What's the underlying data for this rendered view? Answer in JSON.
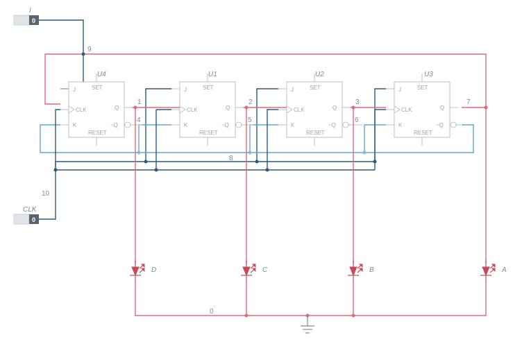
{
  "inputs": {
    "I": {
      "label": "I",
      "value": "0"
    },
    "CLK": {
      "label": "CLK",
      "value": "0"
    }
  },
  "chips": {
    "U4": {
      "name": "U4",
      "set": "SET",
      "reset": "RESET",
      "j": "J",
      "k": "K",
      "clk": "CLK",
      "q": "Q",
      "nq": "~Q"
    },
    "U1": {
      "name": "U1",
      "set": "SET",
      "reset": "RESET",
      "j": "J",
      "k": "K",
      "clk": "CLK",
      "q": "Q",
      "nq": "~Q"
    },
    "U2": {
      "name": "U2",
      "set": "SET",
      "reset": "RESET",
      "j": "J",
      "k": "K",
      "clk": "CLK",
      "q": "Q",
      "nq": "~Q"
    },
    "U3": {
      "name": "U3",
      "set": "SET",
      "reset": "RESET",
      "j": "J",
      "k": "K",
      "clk": "CLK",
      "q": "Q",
      "nq": "~Q"
    }
  },
  "leds": {
    "D": "D",
    "C": "C",
    "B": "B",
    "A": "A"
  },
  "nets": {
    "n1": "1",
    "n2": "2",
    "n3": "3",
    "n4": "4",
    "n5": "5",
    "n6": "6",
    "n7": "7",
    "n8": "8",
    "n9": "9",
    "n10": "10",
    "n0": "0"
  },
  "chart_data": {
    "type": "table",
    "note": "logic schematic, no numeric dataset"
  }
}
